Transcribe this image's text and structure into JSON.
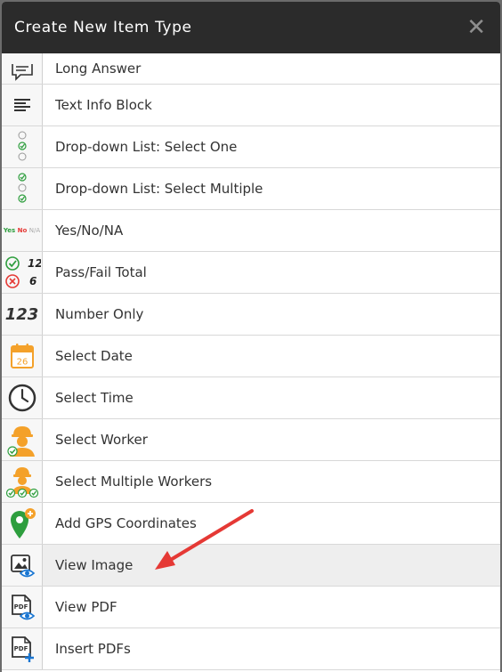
{
  "dialog": {
    "title": "Create New Item Type",
    "close_glyph": "✕"
  },
  "items": [
    {
      "label": "Long Answer",
      "icon": "long-answer-icon"
    },
    {
      "label": "Text Info Block",
      "icon": "text-block-icon"
    },
    {
      "label": "Drop-down List: Select One",
      "icon": "dropdown-single-icon"
    },
    {
      "label": "Drop-down List: Select Multiple",
      "icon": "dropdown-multiple-icon"
    },
    {
      "label": "Yes/No/NA",
      "icon": "yes-no-na-icon"
    },
    {
      "label": "Pass/Fail Total",
      "icon": "pass-fail-icon"
    },
    {
      "label": "Number Only",
      "icon": "number-icon"
    },
    {
      "label": "Select Date",
      "icon": "calendar-icon"
    },
    {
      "label": "Select Time",
      "icon": "clock-icon"
    },
    {
      "label": "Select Worker",
      "icon": "worker-icon"
    },
    {
      "label": "Select Multiple Workers",
      "icon": "workers-icon"
    },
    {
      "label": "Add GPS Coordinates",
      "icon": "gps-pin-icon"
    },
    {
      "label": "View Image",
      "icon": "view-image-icon"
    },
    {
      "label": "View PDF",
      "icon": "view-pdf-icon"
    },
    {
      "label": "Insert PDFs",
      "icon": "insert-pdf-icon"
    }
  ],
  "icon_text": {
    "yes": "Yes",
    "no": "No",
    "na": "N/A",
    "pass_count": "12",
    "fail_count": "6",
    "number": "123",
    "date_day": "26",
    "pdf": "PDF"
  },
  "colors": {
    "header_bg": "#2b2b2b",
    "highlight_row": "#eeeeee",
    "accent_green": "#2e9e3e",
    "accent_orange": "#f4a12a",
    "accent_red": "#e53935",
    "accent_blue": "#1976d2"
  }
}
